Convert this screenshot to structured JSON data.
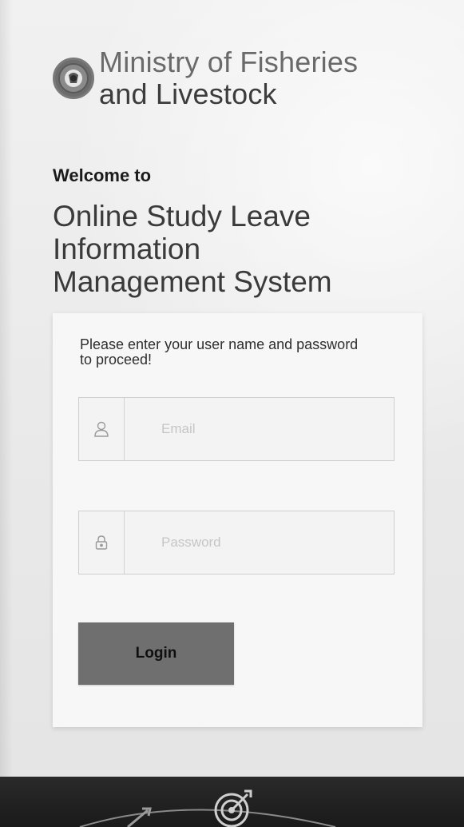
{
  "header": {
    "ministry_line1": "Ministry of Fisheries",
    "ministry_line2": "and Livestock",
    "logo_icon": "government-seal-icon"
  },
  "welcome": {
    "greeting": "Welcome to",
    "system_title_line1": "Online Study Leave",
    "system_title_line2": "Information",
    "system_title_line3": "Management System"
  },
  "login_form": {
    "prompt": "Please enter your user name and password to proceed!",
    "email": {
      "placeholder": "Email",
      "value": "",
      "icon": "user-icon"
    },
    "password": {
      "placeholder": "Password",
      "value": "",
      "icon": "lock-icon"
    },
    "login_label": "Login"
  },
  "footer": {
    "icon": "target-icon"
  },
  "colors": {
    "background": "#e8e8e8",
    "card": "#f7f7f7",
    "button": "#6f6f6f",
    "footer": "#1f1f1f"
  }
}
